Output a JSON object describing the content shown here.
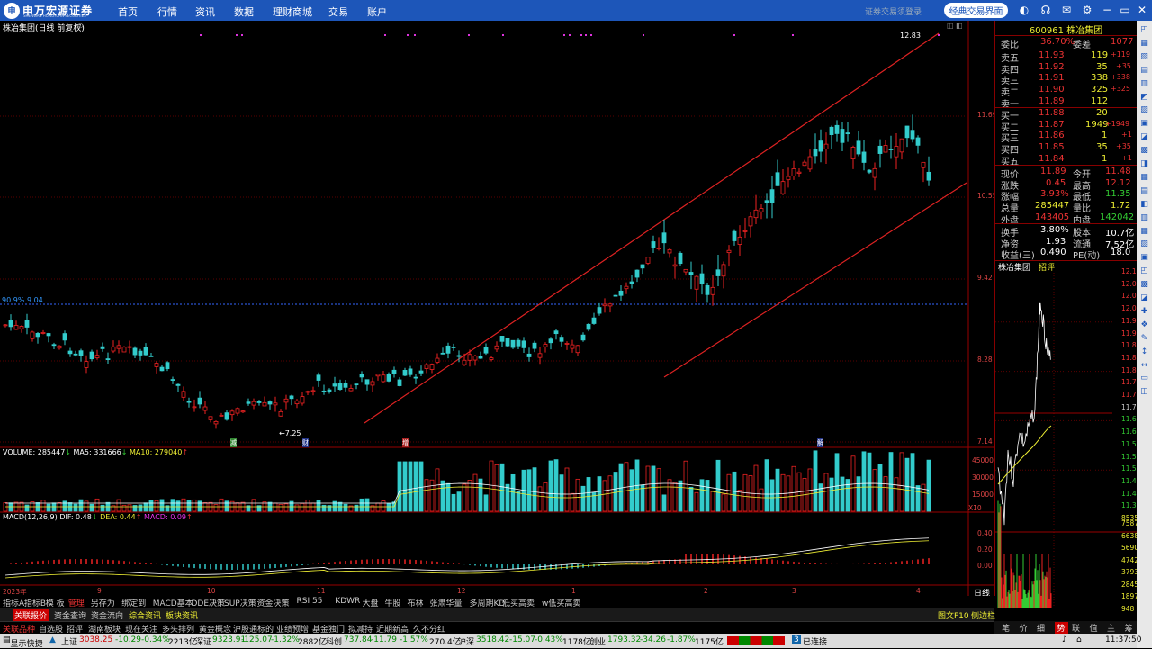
{
  "topbar": {
    "logo_mark": "申",
    "logo_text": "申万宏源证券",
    "logo_en": "SHENWAN HONGYUAN SECURITIES",
    "nav": [
      "首页",
      "行情",
      "资讯",
      "数据",
      "理财商城",
      "交易",
      "账户"
    ],
    "dim_text": "证券交易须登录",
    "classic_button": "经典交易界面"
  },
  "chart": {
    "title": "株冶集团(日线 前复权)",
    "price_axis": [
      "12.83",
      "11.69",
      "10.55",
      "9.42",
      "8.28",
      "7.14"
    ],
    "max_label": "12.83",
    "min_label": "7.25",
    "ref_line_label": "90.9% 9.04",
    "event_marks": [
      "减",
      "财",
      "增",
      "解"
    ],
    "volume_header": {
      "volume": "VOLUME: 285447",
      "ma5": "MA5: 331666",
      "ma10": "MA10: 279040"
    },
    "volume_axis": [
      "45000",
      "30000",
      "15000",
      "X10"
    ],
    "macd_header": {
      "macd": "MACD(12,26,9)",
      "dif": "DIF: 0.48",
      "dea": "DEA: 0.44",
      "macdv": "MACD: 0.09"
    },
    "macd_axis": [
      "0.40",
      "0.20",
      "0.00"
    ],
    "date_labels": [
      "2023年",
      "9",
      "10",
      "11",
      "12",
      "1",
      "2",
      "3",
      "4"
    ],
    "period_label": "日线"
  },
  "quote": {
    "code_name": "600961 株冶集团",
    "weibi_label": "委比",
    "weibi": "36.70%",
    "weicha_label": "委差",
    "weicha": "1077",
    "asks": [
      {
        "label": "卖五",
        "price": "11.93",
        "vol": "119",
        "chg": "+119"
      },
      {
        "label": "卖四",
        "price": "11.92",
        "vol": "35",
        "chg": "+35"
      },
      {
        "label": "卖三",
        "price": "11.91",
        "vol": "338",
        "chg": "+338"
      },
      {
        "label": "卖二",
        "price": "11.90",
        "vol": "325",
        "chg": "+325"
      },
      {
        "label": "卖一",
        "price": "11.89",
        "vol": "112",
        "chg": ""
      }
    ],
    "bids": [
      {
        "label": "买一",
        "price": "11.88",
        "vol": "20",
        "chg": ""
      },
      {
        "label": "买二",
        "price": "11.87",
        "vol": "1949",
        "chg": "+1949"
      },
      {
        "label": "买三",
        "price": "11.86",
        "vol": "1",
        "chg": "+1"
      },
      {
        "label": "买四",
        "price": "11.85",
        "vol": "35",
        "chg": "+35"
      },
      {
        "label": "买五",
        "price": "11.84",
        "vol": "1",
        "chg": "+1"
      }
    ],
    "stats": [
      [
        "现价",
        "11.89",
        "今开",
        "11.48"
      ],
      [
        "涨跌",
        "0.45",
        "最高",
        "12.12"
      ],
      [
        "涨幅",
        "3.93%",
        "最低",
        "11.35"
      ],
      [
        "总量",
        "285447",
        "量比",
        "1.72"
      ],
      [
        "外盘",
        "143405",
        "内盘",
        "142042"
      ]
    ],
    "stats2": [
      [
        "换手",
        "3.80%",
        "股本",
        "10.7亿"
      ],
      [
        "净资",
        "1.93",
        "流通",
        "7.52亿"
      ],
      [
        "收益(三)",
        "0.490",
        "PE(动)",
        "18.0"
      ]
    ]
  },
  "intraday": {
    "name": "株冶集团",
    "tab": "招评",
    "price_axis": [
      "12.12",
      "12.08",
      "12.04",
      "12.00",
      "11.97",
      "11.93",
      "11.89",
      "11.85",
      "11.81",
      "11.78",
      "11.74",
      "11.70",
      "11.66",
      "11.62",
      "11.58",
      "11.54",
      "11.50",
      "11.46",
      "11.43",
      "11.39",
      "8535"
    ],
    "vol_axis": [
      "7587",
      "6638",
      "5690",
      "4742",
      "3793",
      "2845",
      "1897",
      "948"
    ]
  },
  "tabs1": [
    "指标A",
    "指标B",
    "模 板",
    "管理",
    "另存为",
    "绑定到",
    "MACD基本",
    "DDE决策",
    "SUP决策",
    "资金决策",
    "RSI 55",
    "KDWR",
    "大盘",
    "牛股",
    "布林",
    "张肃华量",
    "多周期KD",
    "低买高卖",
    "w低买高卖"
  ],
  "tabs2": [
    "关联报价",
    "资金查询",
    "资金流向",
    "综合资讯",
    "板块资讯"
  ],
  "tabs2_right": [
    "图文F10",
    "侧边栏"
  ],
  "tabs3": [
    "关联品种",
    "自选股",
    "招评",
    "湖南板块",
    "现在关注",
    "多头排列",
    "黄金概念",
    "沪股通标的",
    "业绩预增",
    "基金独门",
    "拟减持",
    "近期新高",
    "久不分红"
  ],
  "rtabs": [
    "笔",
    "价",
    "细",
    "势",
    "联",
    "值",
    "主",
    "筹"
  ],
  "status": {
    "quick": "显示快捷",
    "sh_label": "上证",
    "sh_val": "3038.25",
    "sh_chg": "-10.29",
    "sh_pct": "-0.34%",
    "sh_amt": "2213亿",
    "sz_label": "深证",
    "sz_val": "9323.91",
    "sz_chg": "-125.07",
    "sz_pct": "-1.32%",
    "sz_amt": "2882亿",
    "kc_label": "科创",
    "kc_val": "737.84",
    "kc_chg": "-11.79",
    "kc_pct": "-1.57%",
    "kc_amt": "270.4亿",
    "hs_label": "沪深",
    "hs_val": "3518.42",
    "hs_chg": "-15.07",
    "hs_pct": "-0.43%",
    "hs_amt": "1178亿",
    "cy_label": "创业",
    "cy_val": "1793.32",
    "cy_chg": "-34.26",
    "cy_pct": "-1.87%",
    "cy_amt": "1175亿",
    "conn": "已连接",
    "time": "11:37:50"
  },
  "colors": {
    "up": "#e33",
    "down": "#3cc",
    "bg": "#000",
    "grid": "#7a0000",
    "blue": "#1d56b9"
  }
}
